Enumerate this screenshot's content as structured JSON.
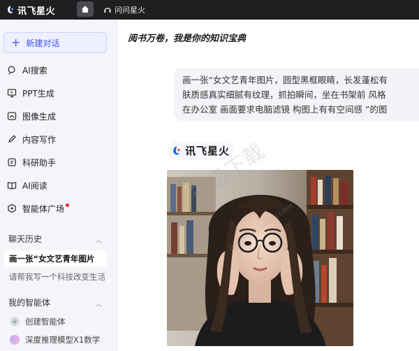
{
  "app": {
    "brand": "讯飞星火"
  },
  "topbar": {
    "nav_label": "问问星火"
  },
  "sidebar": {
    "new_chat_label": "新建对话",
    "items": [
      {
        "label": "AI搜索",
        "icon": "search-icon"
      },
      {
        "label": "PPT生成",
        "icon": "ppt-icon"
      },
      {
        "label": "图像生成",
        "icon": "image-icon"
      },
      {
        "label": "内容写作",
        "icon": "pen-icon"
      },
      {
        "label": "科研助手",
        "icon": "research-icon"
      },
      {
        "label": "AI阅读",
        "icon": "book-icon"
      },
      {
        "label": "智能体广场",
        "icon": "agent-square-icon"
      }
    ],
    "history_title": "聊天历史",
    "history": [
      {
        "label": "画一张“女文艺青年图片"
      },
      {
        "label": "请帮我写一个科技改变生活"
      }
    ],
    "agents_title": "我的智能体",
    "agents": [
      {
        "label": "创建智能体"
      },
      {
        "label": "深度推理模型X1数学"
      }
    ]
  },
  "main": {
    "slogan": "阅书万卷，我是你的知识宝典",
    "user_message": [
      "画一张“女文艺青年图片，圆型黑框眼睛，长发蓬松有",
      "肤质感真实细腻有纹理，抓拍瞬间，坐在书架前 风格",
      "在办公室 画面要求电脑滤镜 构图上有有空间感 ”的图"
    ],
    "reply_brand": "讯飞星火",
    "watermark": "天极下载",
    "watermark_url": "my.down.yesky.com"
  }
}
